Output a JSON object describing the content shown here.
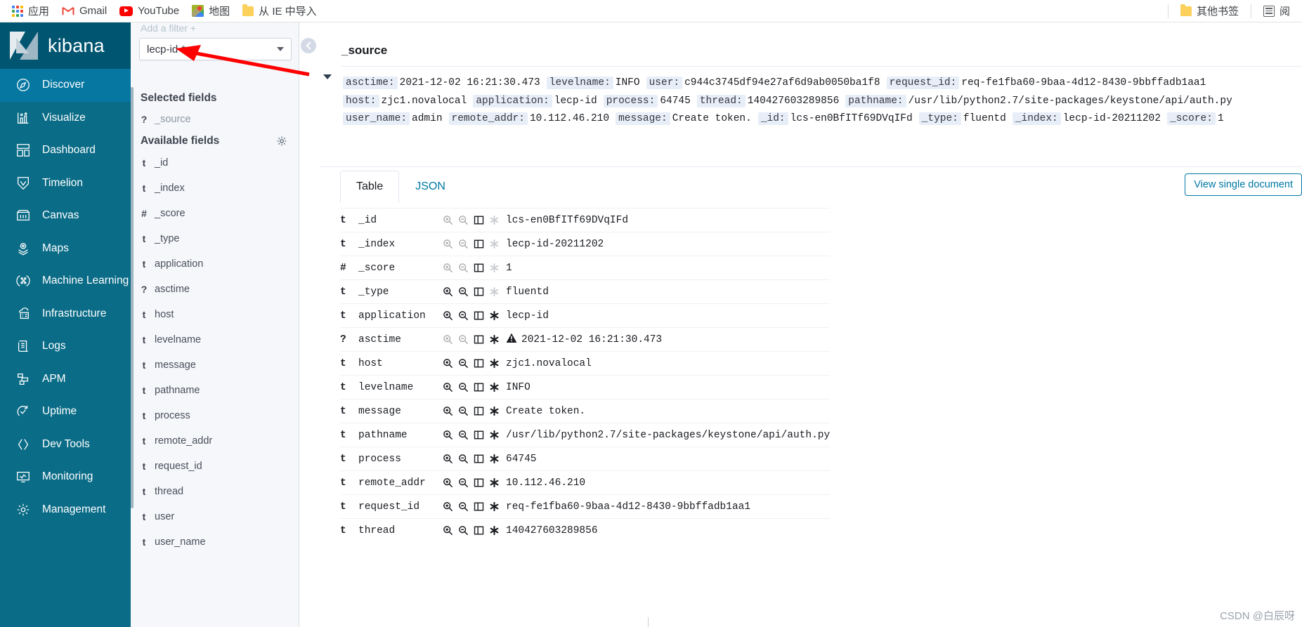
{
  "browser": {
    "bookmarks": [
      {
        "label": "应用",
        "icon": "apps-grid-icon"
      },
      {
        "label": "Gmail",
        "icon": "gmail-icon"
      },
      {
        "label": "YouTube",
        "icon": "youtube-icon"
      },
      {
        "label": "地图",
        "icon": "google-maps-icon"
      },
      {
        "label": "从 IE 中导入",
        "icon": "folder-icon"
      }
    ],
    "right_items": [
      {
        "label": "其他书签",
        "icon": "folder-icon"
      },
      {
        "label": "阅",
        "icon": "reading-list-icon"
      }
    ]
  },
  "sidebar": {
    "brand": "kibana",
    "logo_icon": "kibana-logo-icon",
    "items": [
      {
        "label": "Discover",
        "icon": "discover-icon",
        "active": true
      },
      {
        "label": "Visualize",
        "icon": "visualize-icon",
        "active": false
      },
      {
        "label": "Dashboard",
        "icon": "dashboard-icon",
        "active": false
      },
      {
        "label": "Timelion",
        "icon": "timelion-icon",
        "active": false
      },
      {
        "label": "Canvas",
        "icon": "canvas-icon",
        "active": false
      },
      {
        "label": "Maps",
        "icon": "maps-icon",
        "active": false
      },
      {
        "label": "Machine Learning",
        "icon": "machine-learning-icon",
        "active": false
      },
      {
        "label": "Infrastructure",
        "icon": "infrastructure-icon",
        "active": false
      },
      {
        "label": "Logs",
        "icon": "logs-icon",
        "active": false
      },
      {
        "label": "APM",
        "icon": "apm-icon",
        "active": false
      },
      {
        "label": "Uptime",
        "icon": "uptime-icon",
        "active": false
      },
      {
        "label": "Dev Tools",
        "icon": "dev-tools-icon",
        "active": false
      },
      {
        "label": "Monitoring",
        "icon": "monitoring-icon",
        "active": false
      },
      {
        "label": "Management",
        "icon": "management-icon",
        "active": false
      }
    ]
  },
  "fieldbar": {
    "filter_ghost": "Add a filter +",
    "index_pattern": "lecp-id-*",
    "selected_heading": "Selected fields",
    "available_heading": "Available fields",
    "settings_icon": "gear-icon",
    "selected_fields": [
      {
        "type": "?",
        "name": "_source"
      }
    ],
    "available_fields": [
      {
        "type": "t",
        "name": "_id"
      },
      {
        "type": "t",
        "name": "_index"
      },
      {
        "type": "#",
        "name": "_score"
      },
      {
        "type": "t",
        "name": "_type"
      },
      {
        "type": "t",
        "name": "application"
      },
      {
        "type": "?",
        "name": "asctime"
      },
      {
        "type": "t",
        "name": "host"
      },
      {
        "type": "t",
        "name": "levelname"
      },
      {
        "type": "t",
        "name": "message"
      },
      {
        "type": "t",
        "name": "pathname"
      },
      {
        "type": "t",
        "name": "process"
      },
      {
        "type": "t",
        "name": "remote_addr"
      },
      {
        "type": "t",
        "name": "request_id"
      },
      {
        "type": "t",
        "name": "thread"
      },
      {
        "type": "t",
        "name": "user"
      },
      {
        "type": "t",
        "name": "user_name"
      }
    ]
  },
  "document": {
    "title": "_source",
    "collapse_icon": "collapse-left-icon",
    "expand_icon": "caret-down-icon",
    "source_lines": [
      [
        {
          "key": "asctime:",
          "val": "2021-12-02 16:21:30.473"
        },
        {
          "key": "levelname:",
          "val": "INFO"
        },
        {
          "key": "user:",
          "val": "c944c3745df94e27af6d9ab0050ba1f8"
        },
        {
          "key": "request_id:",
          "val": "req-fe1fba60-9baa-4d12-8430-9bbffadb1aa1"
        }
      ],
      [
        {
          "key": "host:",
          "val": "zjc1.novalocal"
        },
        {
          "key": "application:",
          "val": "lecp-id"
        },
        {
          "key": "process:",
          "val": "64745"
        },
        {
          "key": "thread:",
          "val": "140427603289856"
        },
        {
          "key": "pathname:",
          "val": "/usr/lib/python2.7/site-packages/keystone/api/auth.py"
        }
      ],
      [
        {
          "key": "user_name:",
          "val": "admin"
        },
        {
          "key": "remote_addr:",
          "val": "10.112.46.210"
        },
        {
          "key": "message:",
          "val": "Create token."
        },
        {
          "key": "_id:",
          "val": "lcs-en0BfITf69DVqIFd"
        },
        {
          "key": "_type:",
          "val": "fluentd"
        },
        {
          "key": "_index:",
          "val": "lecp-id-20211202"
        },
        {
          "key": "_score:",
          "val": "1"
        }
      ]
    ],
    "tabs": [
      {
        "label": "Table",
        "active": true
      },
      {
        "label": "JSON",
        "active": false
      }
    ],
    "view_single_label": "View single document",
    "row_actions": [
      {
        "icon": "filter-for-value-icon",
        "title": "Filter for value"
      },
      {
        "icon": "filter-out-value-icon",
        "title": "Filter out value"
      },
      {
        "icon": "toggle-column-in-table-icon",
        "title": "Toggle column in table"
      },
      {
        "icon": "filter-for-field-present-icon",
        "title": "Filter for field present"
      }
    ],
    "rows": [
      {
        "type": "t",
        "field": "_id",
        "value": "lcs-en0BfITf69DVqIFd",
        "dim_actions": true,
        "warn": false
      },
      {
        "type": "t",
        "field": "_index",
        "value": "lecp-id-20211202",
        "dim_actions": true,
        "warn": false
      },
      {
        "type": "#",
        "field": "_score",
        "value": "1",
        "dim_actions": true,
        "warn": false
      },
      {
        "type": "t",
        "field": "_type",
        "value": "fluentd",
        "dim_actions": true,
        "warn": false
      },
      {
        "type": "t",
        "field": "application",
        "value": "lecp-id",
        "dim_actions": false,
        "warn": false
      },
      {
        "type": "?",
        "field": "asctime",
        "value": "2021-12-02 16:21:30.473",
        "dim_actions": true,
        "warn": true
      },
      {
        "type": "t",
        "field": "host",
        "value": "zjc1.novalocal",
        "dim_actions": false,
        "warn": false
      },
      {
        "type": "t",
        "field": "levelname",
        "value": "INFO",
        "dim_actions": false,
        "warn": false
      },
      {
        "type": "t",
        "field": "message",
        "value": "Create token.",
        "dim_actions": false,
        "warn": false
      },
      {
        "type": "t",
        "field": "pathname",
        "value": "/usr/lib/python2.7/site-packages/keystone/api/auth.py",
        "dim_actions": false,
        "warn": false
      },
      {
        "type": "t",
        "field": "process",
        "value": "64745",
        "dim_actions": false,
        "warn": false
      },
      {
        "type": "t",
        "field": "remote_addr",
        "value": "10.112.46.210",
        "dim_actions": false,
        "warn": false
      },
      {
        "type": "t",
        "field": "request_id",
        "value": "req-fe1fba60-9baa-4d12-8430-9bbffadb1aa1",
        "dim_actions": false,
        "warn": false
      },
      {
        "type": "t",
        "field": "thread",
        "value": "140427603289856",
        "dim_actions": false,
        "warn": false
      }
    ]
  },
  "annotation": {
    "arrow_color": "#ff0000",
    "target": "index-pattern-select"
  },
  "watermark": "CSDN @白辰呀",
  "colors": {
    "sidebar_bg": "#0a6c87",
    "sidebar_brand_bg": "#005571",
    "sidebar_active": "#0677a1",
    "link": "#0079a5",
    "fieldbar_bg": "#f5f7fa",
    "key_chip_bg": "#e7eef7"
  }
}
